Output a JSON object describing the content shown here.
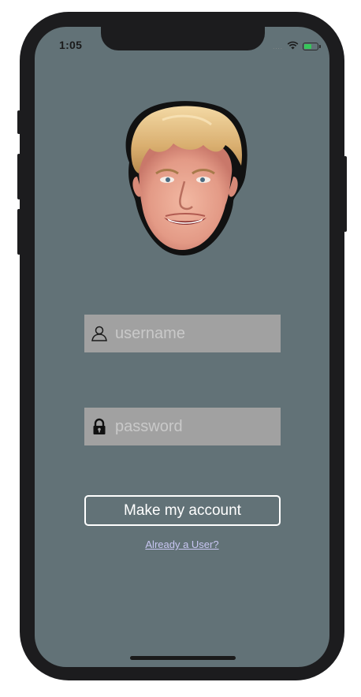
{
  "status_bar": {
    "time": "1:05",
    "signal": "....",
    "wifi_icon": "wifi-icon",
    "battery_icon": "battery-charging-icon"
  },
  "avatar": {
    "icon": "face-avatar-image"
  },
  "username_field": {
    "icon": "user-icon",
    "placeholder": "username",
    "value": ""
  },
  "password_field": {
    "icon": "lock-icon",
    "placeholder": "password",
    "value": ""
  },
  "make_account_button": {
    "label": "Make my account"
  },
  "already_user_link": {
    "label": "Already a User?"
  },
  "colors": {
    "screen_background": "#627277",
    "field_background": "#a1a1a1",
    "link": "#c8c6f2",
    "button_border": "#ffffff"
  }
}
